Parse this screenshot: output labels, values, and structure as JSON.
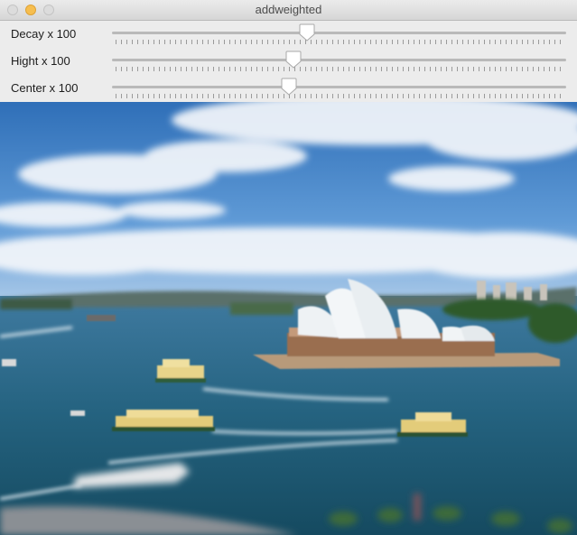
{
  "window": {
    "title": "addweighted"
  },
  "sliders": [
    {
      "label": "Decay x 100",
      "value": 43
    },
    {
      "label": "Hight x 100",
      "value": 40
    },
    {
      "label": "Center x 100",
      "value": 39
    }
  ],
  "image": {
    "subject": "sydney-opera-house-harbor-photo"
  }
}
